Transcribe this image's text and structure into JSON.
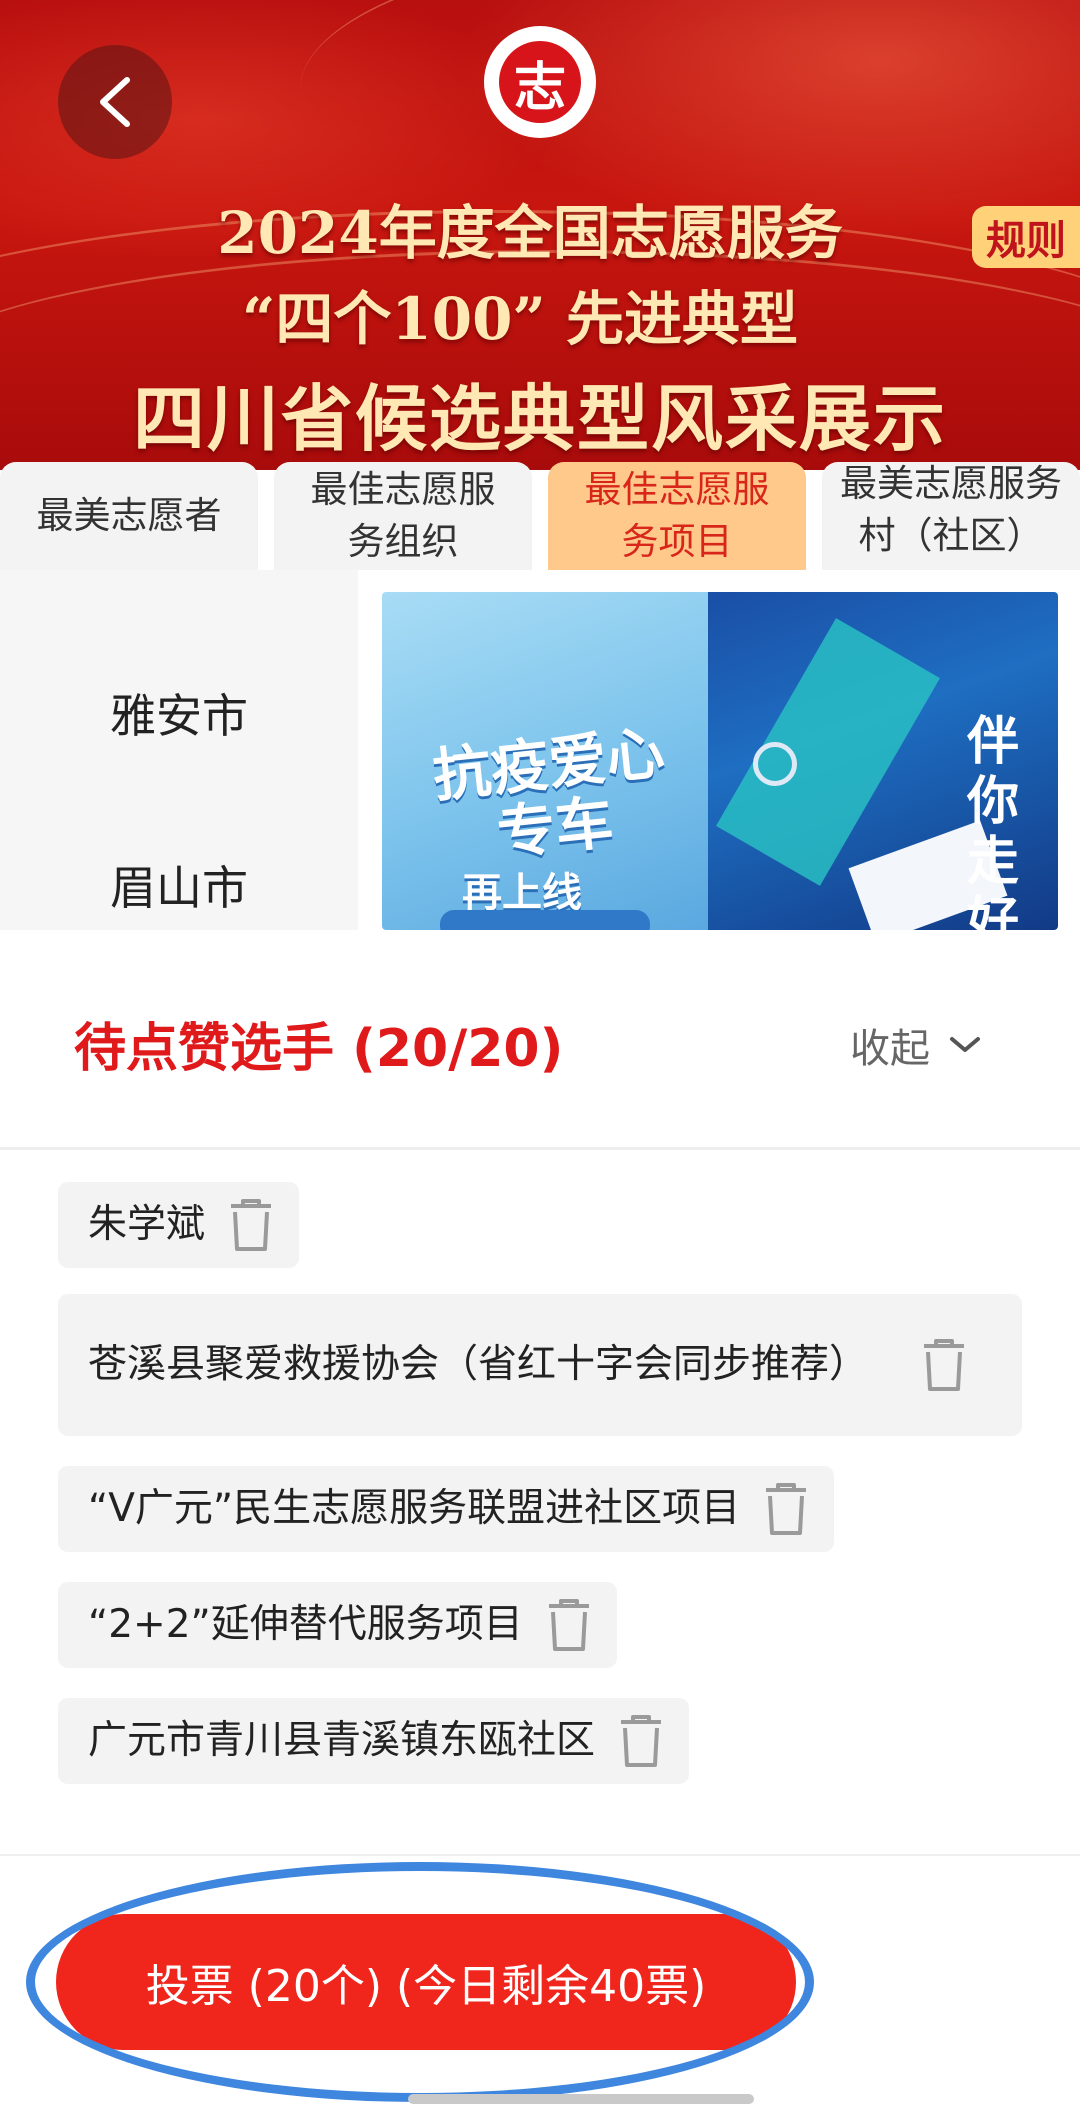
{
  "banner": {
    "title_line1": "2024年度全国志愿服务",
    "title_line2": "“四个100” 先进典型",
    "title_line3": "四川省候选典型风采展示",
    "logo_char": "志",
    "rules_label": "规则"
  },
  "tabs": [
    {
      "label": "最美志愿者",
      "active": false
    },
    {
      "label": "最佳志愿服务组织",
      "active": false
    },
    {
      "label": "最佳志愿服务项目",
      "active": true
    },
    {
      "label": "最美志愿服务村（社区）",
      "active": false
    }
  ],
  "regions": [
    "雅安市",
    "眉山市"
  ],
  "preview": {
    "left_headline": "抗疫爱心专车",
    "left_sub": "再上线",
    "right_headline": "伴你走好"
  },
  "sheet": {
    "title": "待点赞选手 (20/20)",
    "collapse_label": "收起",
    "selected": [
      "朱学斌",
      "苍溪县聚爱救援协会（省红十字会同步推荐）",
      "“V广元”民生志愿服务联盟进社区项目",
      "“2+2”延伸替代服务项目",
      "广元市青川县青溪镇东瓯社区"
    ],
    "vote_label": "投票 (20个) (今日剩余40票)"
  },
  "colors": {
    "brand_red": "#e0191b",
    "vote_button": "#f0261c",
    "active_tab_bg": "#ffc98b",
    "highlight_ring": "#3f86df"
  }
}
